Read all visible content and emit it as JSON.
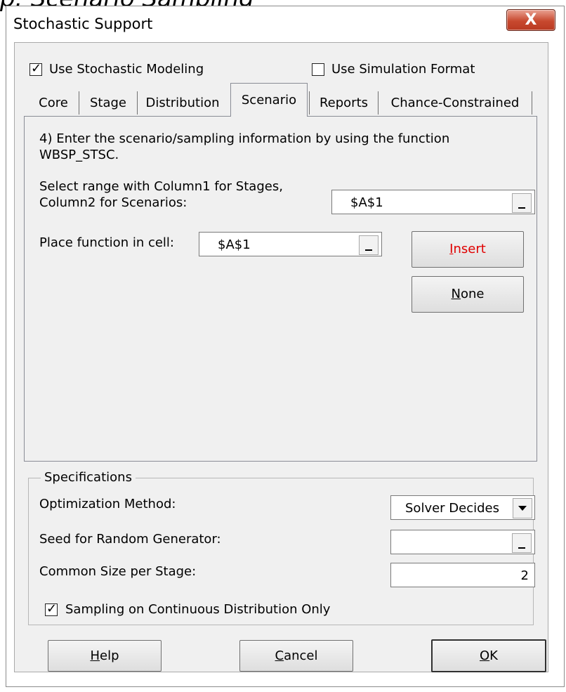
{
  "cutoff_heading": "p:  Scenario Sampling",
  "window": {
    "title": "Stochastic Support",
    "close_glyph": "X"
  },
  "top_options": {
    "use_stochastic": {
      "label": "Use Stochastic Modeling",
      "checked": true
    },
    "use_simulation": {
      "label": "Use Simulation Format",
      "checked": false
    }
  },
  "tabs": [
    {
      "label": "Core",
      "active": false
    },
    {
      "label": "Stage",
      "active": false
    },
    {
      "label": "Distribution",
      "active": false
    },
    {
      "label": "Scenario",
      "active": true
    },
    {
      "label": "Reports",
      "active": false
    },
    {
      "label": "Chance-Constrained",
      "active": false
    }
  ],
  "scenario": {
    "instruction": "4) Enter the scenario/sampling information by using the function WBSP_STSC.",
    "range_label_1": "Select range with Column1 for Stages,",
    "range_label_2": "Column2 for Scenarios:",
    "range_value": "$A$1",
    "place_label": "Place function in cell:",
    "place_value": "$A$1",
    "insert_button": {
      "pre": "",
      "ul": "I",
      "post": "nsert",
      "color": "#e00000"
    },
    "none_button": {
      "pre": "",
      "ul": "N",
      "post": "one"
    }
  },
  "specifications": {
    "title": "Specifications",
    "method_label": "Optimization Method:",
    "method_value": "Solver Decides",
    "seed_label": "Seed for Random Generator:",
    "seed_value": "",
    "size_label": "Common Size per Stage:",
    "size_value": "2",
    "sampling": {
      "label": "Sampling on Continuous Distribution Only",
      "checked": true
    }
  },
  "footer": {
    "help": {
      "pre": "",
      "ul": "H",
      "post": "elp"
    },
    "cancel": {
      "pre": "",
      "ul": "C",
      "post": "ancel"
    },
    "ok": {
      "pre": "",
      "ul": "O",
      "post": "K"
    }
  },
  "colors": {
    "dialog_bg": "#f0f0f0",
    "close_red": "#c8492f",
    "accent_insert": "#e00000"
  },
  "icons": {
    "check": "check-mark",
    "dropdown": "chevron-down",
    "range_picker": "minimize-dash"
  }
}
